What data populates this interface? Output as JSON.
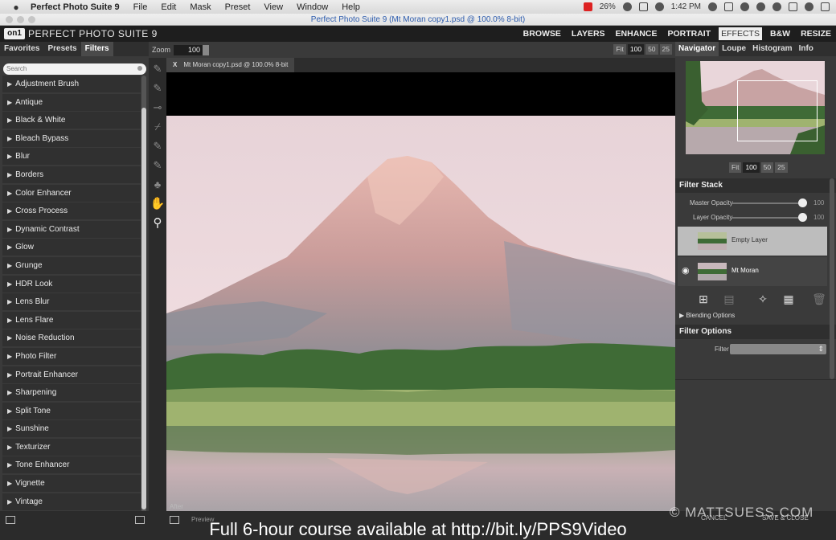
{
  "menubar": {
    "app_name": "Perfect Photo Suite 9",
    "items": [
      "File",
      "Edit",
      "Mask",
      "Preset",
      "View",
      "Window",
      "Help"
    ],
    "battery": "26%",
    "time": "1:42 PM"
  },
  "window": {
    "title": "Perfect Photo Suite 9 (Mt Moran copy1.psd @ 100.0% 8-bit)"
  },
  "header": {
    "logo": "on1",
    "product": "PERFECT PHOTO SUITE 9",
    "modules": [
      "BROWSE",
      "LAYERS",
      "ENHANCE",
      "PORTRAIT",
      "EFFECTS",
      "B&W",
      "RESIZE"
    ],
    "active_module": "EFFECTS"
  },
  "left_panel": {
    "tabs": [
      "Favorites",
      "Presets",
      "Filters"
    ],
    "active_tab": "Filters",
    "search_placeholder": "Search",
    "filters": [
      "Adjustment Brush",
      "Antique",
      "Black & White",
      "Bleach Bypass",
      "Blur",
      "Borders",
      "Color Enhancer",
      "Cross Process",
      "Dynamic Contrast",
      "Glow",
      "Grunge",
      "HDR Look",
      "Lens Blur",
      "Lens Flare",
      "Noise Reduction",
      "Photo Filter",
      "Portrait Enhancer",
      "Sharpening",
      "Split Tone",
      "Sunshine",
      "Texturizer",
      "Tone Enhancer",
      "Vignette",
      "Vintage"
    ]
  },
  "zoom": {
    "label": "Zoom",
    "value": "100",
    "buttons": [
      "Fit",
      "100",
      "50",
      "25"
    ]
  },
  "document": {
    "tab_close": "X",
    "tab_label": "Mt Moran copy1.psd @ 100.0% 8-bit",
    "after_label": "After"
  },
  "right_panel": {
    "tabs": [
      "Navigator",
      "Loupe",
      "Histogram",
      "Info"
    ],
    "active_tab": "Navigator",
    "nav_buttons": [
      "Fit",
      "100",
      "50",
      "25"
    ],
    "filter_stack": {
      "title": "Filter Stack",
      "master_opacity_label": "Master Opacity",
      "master_opacity_value": "100",
      "layer_opacity_label": "Layer Opacity",
      "layer_opacity_value": "100",
      "layers": [
        "Empty Layer",
        "Mt Moran"
      ],
      "blending_options": "Blending Options"
    },
    "filter_options": {
      "title": "Filter Options",
      "filter_label": "Filter"
    }
  },
  "bottom": {
    "preview_label": "Preview",
    "cancel": "CANCEL",
    "save_close": "SAVE & CLOSE"
  },
  "overlay": {
    "watermark": "© MATTSUESS.COM",
    "caption": "Full 6-hour course available at http://bit.ly/PPS9Video"
  },
  "colors": {
    "panel_bg": "#3a3a3a",
    "header_bg": "#1e1e1e",
    "list_item_bg": "#303030",
    "active_module_bg": "#eeeeee"
  }
}
